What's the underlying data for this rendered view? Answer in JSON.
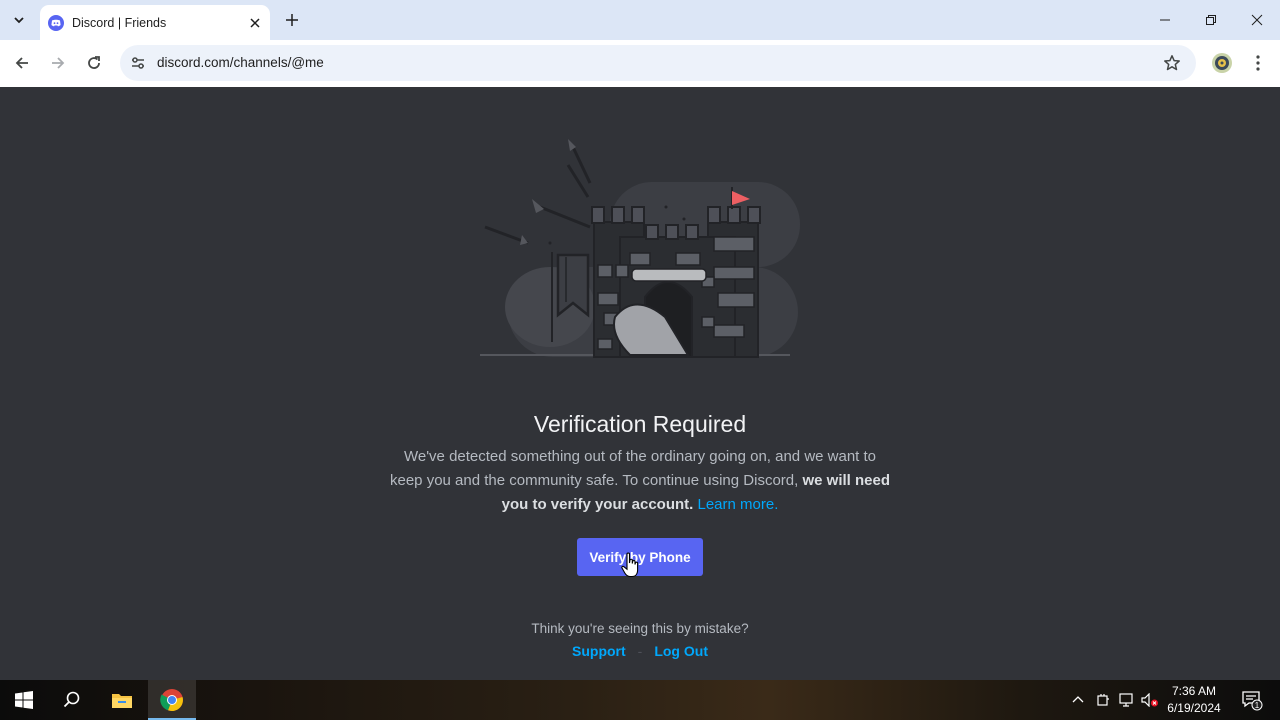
{
  "browser": {
    "tab_title": "Discord | Friends",
    "url": "discord.com/channels/@me",
    "icons": {
      "tab_search": "chevron-down-icon",
      "favicon": "discord-icon",
      "close": "close-icon",
      "new_tab": "plus-icon",
      "back": "back-arrow-icon",
      "forward": "forward-arrow-icon",
      "reload": "reload-icon",
      "site_info": "tune-icon",
      "bookmark": "star-icon",
      "extension": "extension-icon",
      "menu": "kebab-menu-icon"
    }
  },
  "page": {
    "heading": "Verification Required",
    "description_part1": "We've detected something out of the ordinary going on, and we want to keep you and the community safe. To continue using Discord,",
    "description_bold": "we will need you to verify your account.",
    "learn_more": "Learn more.",
    "verify_button": "Verify by Phone",
    "mistake_text": "Think you're seeing this by mistake?",
    "support_link": "Support",
    "separator": "-",
    "logout_link": "Log Out"
  },
  "taskbar": {
    "time": "7:36 AM",
    "date": "6/19/2024",
    "notification_count": "1",
    "icons": [
      "windows-start-icon",
      "search-icon",
      "file-explorer-icon",
      "chrome-icon"
    ]
  },
  "colors": {
    "background": "#313338",
    "accent": "#5865f2",
    "link": "#00a8fc",
    "heading": "#f2f3f5",
    "body_text": "#b5bac1"
  }
}
